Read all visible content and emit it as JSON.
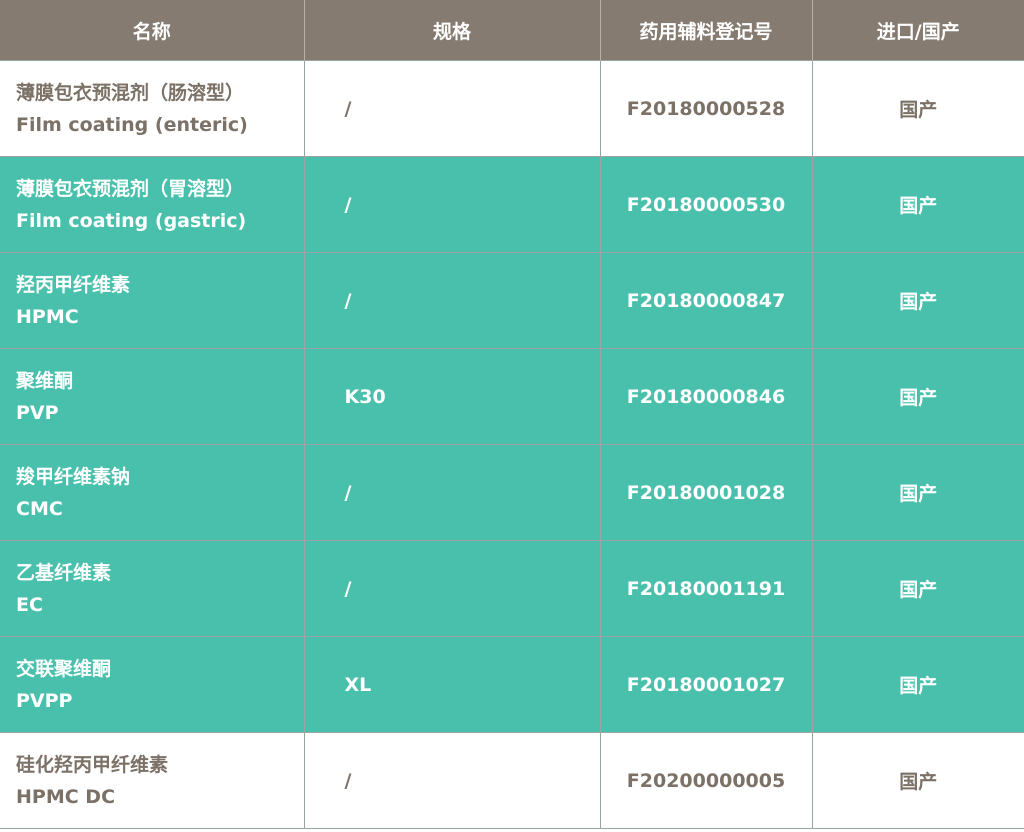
{
  "headers": {
    "name": "名称",
    "spec": "规格",
    "registration": "药用辅料登记号",
    "origin": "进口/国产"
  },
  "rows": [
    {
      "cn": "薄膜包衣预混剂（肠溶型）",
      "en": "Film coating (enteric)",
      "spec": "/",
      "reg": "F20180000528",
      "origin": "国产",
      "highlight": false
    },
    {
      "cn": "薄膜包衣预混剂（胃溶型）",
      "en": "Film coating (gastric)",
      "spec": "/",
      "reg": "F20180000530",
      "origin": "国产",
      "highlight": true
    },
    {
      "cn": "羟丙甲纤维素",
      "en": "HPMC",
      "spec": "/",
      "reg": "F20180000847",
      "origin": "国产",
      "highlight": true
    },
    {
      "cn": "聚维酮",
      "en": "PVP",
      "spec": "K30",
      "reg": "F20180000846",
      "origin": "国产",
      "highlight": true
    },
    {
      "cn": "羧甲纤维素钠",
      "en": "CMC",
      "spec": "/",
      "reg": "F20180001028",
      "origin": "国产",
      "highlight": true
    },
    {
      "cn": "乙基纤维素",
      "en": "EC",
      "spec": "/",
      "reg": "F20180001191",
      "origin": "国产",
      "highlight": true
    },
    {
      "cn": "交联聚维酮",
      "en": "PVPP",
      "spec": "XL",
      "reg": "F20180001027",
      "origin": "国产",
      "highlight": true
    },
    {
      "cn": "硅化羟丙甲纤维素",
      "en": "HPMC DC",
      "spec": "/",
      "reg": "F20200000005",
      "origin": "国产",
      "highlight": false
    }
  ],
  "colors": {
    "header_bg": "#857b71",
    "highlight_bg": "#49c0ab",
    "plain_text": "#7b7167"
  }
}
